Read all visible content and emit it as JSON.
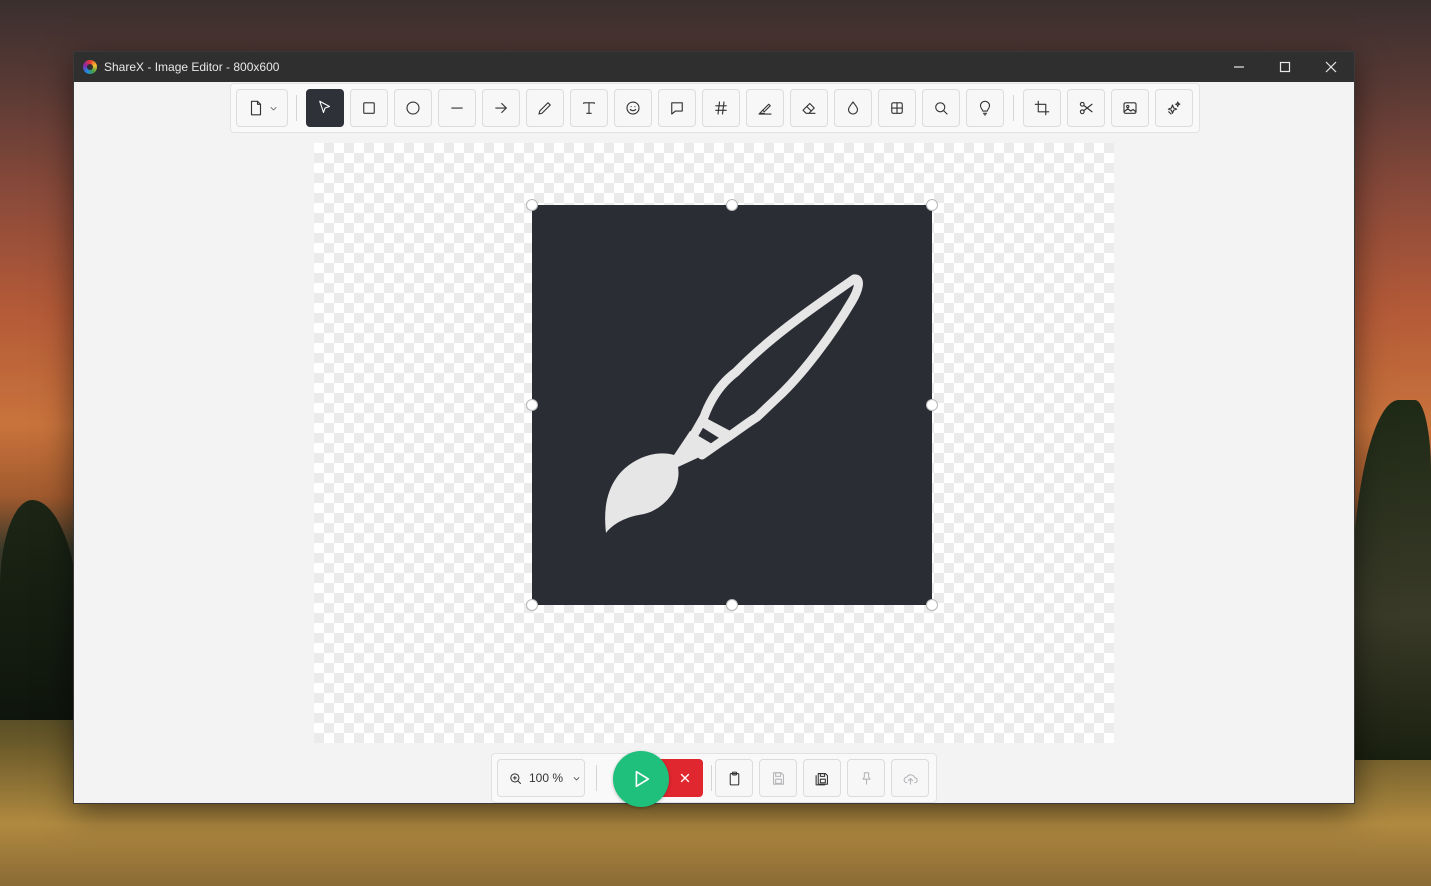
{
  "window": {
    "title": "ShareX - Image Editor - 800x600"
  },
  "titlebar": {
    "buttons": [
      {
        "name": "minimize",
        "icon": "minimize-icon"
      },
      {
        "name": "maximize",
        "icon": "maximize-icon"
      },
      {
        "name": "close",
        "icon": "close-icon"
      }
    ]
  },
  "toolbar": {
    "tools": [
      {
        "name": "new-image",
        "icon": "file-icon",
        "dropdown": true
      },
      {
        "name": "select",
        "icon": "cursor-icon",
        "active": true
      },
      {
        "name": "rectangle",
        "icon": "rectangle-icon"
      },
      {
        "name": "ellipse",
        "icon": "ellipse-icon"
      },
      {
        "name": "line",
        "icon": "line-icon"
      },
      {
        "name": "arrow",
        "icon": "arrow-icon"
      },
      {
        "name": "freehand",
        "icon": "pencil-icon"
      },
      {
        "name": "text",
        "icon": "text-icon"
      },
      {
        "name": "emoji",
        "icon": "smiley-icon"
      },
      {
        "name": "speech-balloon",
        "icon": "speech-bubble-icon"
      },
      {
        "name": "step",
        "icon": "hash-icon"
      },
      {
        "name": "highlight",
        "icon": "highlighter-icon"
      },
      {
        "name": "eraser",
        "icon": "eraser-icon"
      },
      {
        "name": "blur",
        "icon": "droplet-icon"
      },
      {
        "name": "pixelate",
        "icon": "grid-icon"
      },
      {
        "name": "magnify",
        "icon": "magnifier-icon"
      },
      {
        "name": "spotlight",
        "icon": "lightbulb-icon"
      },
      {
        "name": "crop",
        "icon": "crop-icon"
      },
      {
        "name": "cut-out",
        "icon": "scissors-icon"
      },
      {
        "name": "image",
        "icon": "image-icon"
      },
      {
        "name": "sticker",
        "icon": "sparkle-icon"
      }
    ]
  },
  "canvas": {
    "width": 800,
    "height": 600,
    "background": "transparent-checker",
    "object": {
      "type": "image",
      "icon": "paintbrush-icon",
      "fill": "#2b2d34",
      "selected": true
    }
  },
  "bottombar": {
    "zoom_label": "100 %",
    "run_icon": "play-icon",
    "cancel_icon": "close-icon",
    "buttons": [
      {
        "name": "copy-to-clipboard",
        "icon": "clipboard-icon",
        "enabled": true
      },
      {
        "name": "save",
        "icon": "save-icon",
        "enabled": false
      },
      {
        "name": "save-as",
        "icon": "save-as-icon",
        "enabled": true
      },
      {
        "name": "pin-to-screen",
        "icon": "pin-icon",
        "enabled": false
      },
      {
        "name": "upload",
        "icon": "upload-icon",
        "enabled": false
      }
    ]
  },
  "colors": {
    "accent_run": "#1fbf7c",
    "accent_cancel": "#e0262f",
    "titlebar": "#2f2f30",
    "active_tool": "#2e3138"
  }
}
